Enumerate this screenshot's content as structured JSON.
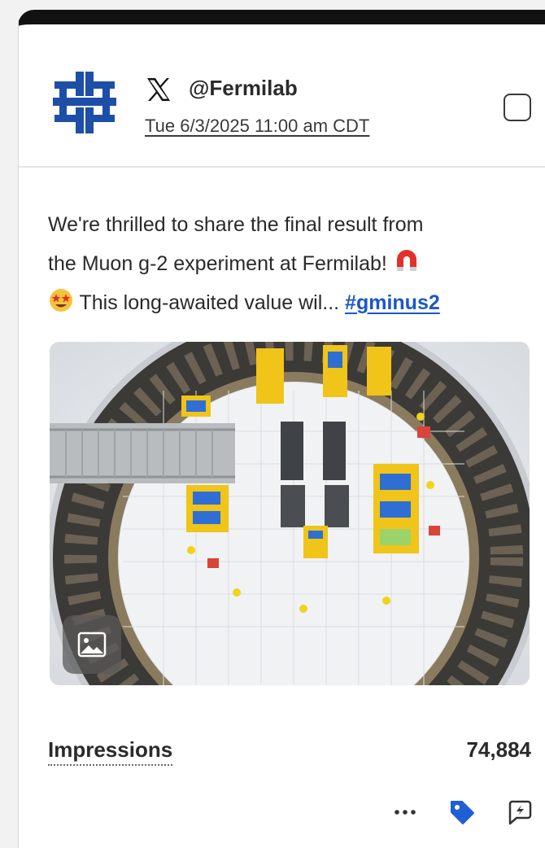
{
  "post": {
    "platform_icon": "x-logo-icon",
    "account_logo": "fermilab-logo",
    "handle": "@Fermilab",
    "timestamp": "Tue 6/3/2025 11:00 am CDT",
    "text_line_1": "We're thrilled to share the final result from",
    "text_line_2": "the Muon g-2 experiment at Fermilab!",
    "emoji_1": "magnet-emoji",
    "emoji_2": "star-struck-emoji",
    "text_line_3": "This long-awaited value wil...",
    "hashtag": "#gminus2",
    "media_type": "image-icon"
  },
  "stats": {
    "label": "Impressions",
    "value": "74,884"
  },
  "actions": [
    {
      "icon": "more-icon"
    },
    {
      "icon": "tag-icon"
    },
    {
      "icon": "boost-icon"
    }
  ],
  "colors": {
    "brand_blue": "#1d4fa8",
    "link": "#1a57c9",
    "tag": "#1f5fd6"
  }
}
